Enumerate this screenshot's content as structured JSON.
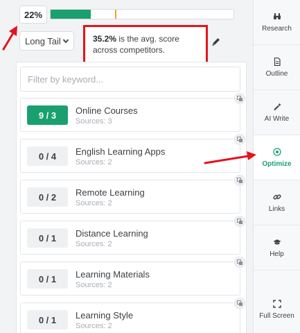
{
  "score": {
    "value": "22%",
    "fill_fraction": 0.22,
    "avg_fraction": 0.352
  },
  "filter_type": {
    "selected": "Long Tail"
  },
  "tooltip": {
    "highlight": "35.2%",
    "text_rest": " is the avg. score across competitors."
  },
  "search": {
    "placeholder": "Filter by keyword..."
  },
  "keywords": [
    {
      "badge": "9 / 3",
      "name": "Online Courses",
      "sources": "Sources: 3",
      "status": "good"
    },
    {
      "badge": "0 / 4",
      "name": "English Learning Apps",
      "sources": "Sources: 2",
      "status": "none"
    },
    {
      "badge": "0 / 2",
      "name": "Remote Learning",
      "sources": "Sources: 2",
      "status": "none"
    },
    {
      "badge": "0 / 1",
      "name": "Distance Learning",
      "sources": "Sources: 2",
      "status": "none"
    },
    {
      "badge": "0 / 1",
      "name": "Learning Materials",
      "sources": "Sources: 2",
      "status": "none"
    },
    {
      "badge": "0 / 1",
      "name": "Learning Style",
      "sources": "Sources: 2",
      "status": "none"
    }
  ],
  "sidebar": {
    "items": [
      {
        "label": "Research",
        "icon": "binoculars-icon"
      },
      {
        "label": "Outline",
        "icon": "document-icon"
      },
      {
        "label": "AI Write",
        "icon": "magic-wand-icon"
      },
      {
        "label": "Optimize",
        "icon": "target-icon",
        "active": true
      },
      {
        "label": "Links",
        "icon": "link-icon"
      },
      {
        "label": "Help",
        "icon": "graduation-cap-icon"
      },
      {
        "label": "Full Screen",
        "icon": "expand-icon"
      }
    ]
  },
  "colors": {
    "accent": "#1aa06f",
    "annotation": "#e3141c",
    "marker": "#f0a020"
  }
}
